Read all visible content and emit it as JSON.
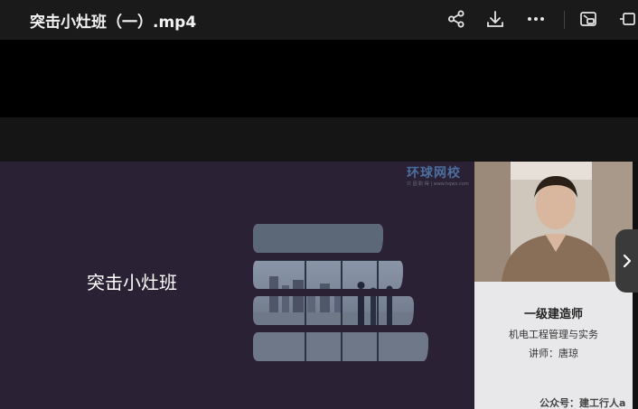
{
  "header": {
    "title": "突击小灶班（一）.mp4",
    "icons": [
      "share-icon",
      "download-icon",
      "more-icon",
      "picture-in-picture-icon",
      "float-window-icon"
    ]
  },
  "slide": {
    "title": "突击小灶班",
    "watermark_main": "环球网校",
    "watermark_sub": "只 因 职 得 | www.hqwx.com",
    "colors": {
      "background": "#2a2234",
      "accent": "#4d6fa0"
    }
  },
  "presenter": {
    "certificate": "一级建造师",
    "course": "机电工程管理与实务",
    "teacher": "讲师：唐琼",
    "footer": "公众号：建工行人a"
  },
  "controls": {
    "next_icon": "chevron-right-icon"
  }
}
